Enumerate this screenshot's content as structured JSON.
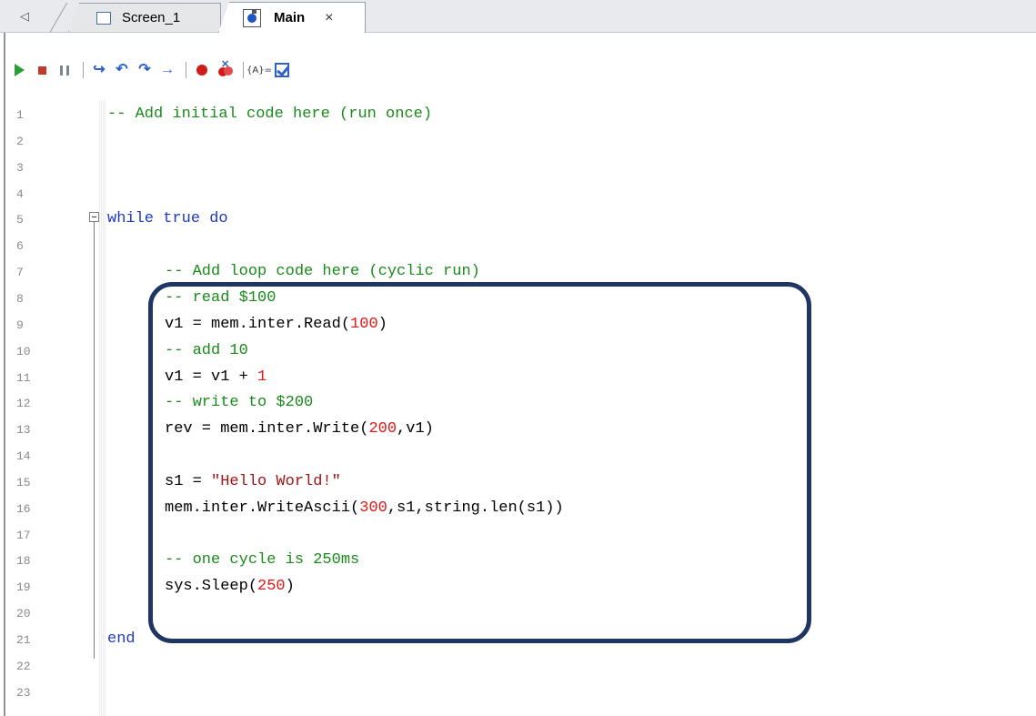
{
  "tabs": {
    "items": [
      {
        "label": "Screen_1",
        "icon": "screen-icon"
      },
      {
        "label": "Main",
        "icon": "script-icon",
        "close": "×"
      }
    ]
  },
  "toolbar": {
    "buttons": [
      "play-icon",
      "stop-icon",
      "pause-icon",
      "step-into-icon",
      "step-over-icon",
      "step-out-icon",
      "run-to-cursor-icon",
      "breakpoint-icon",
      "clear-breakpoints-icon",
      "watch-icon",
      "check-syntax-icon"
    ],
    "watch_label": "{A}="
  },
  "editor": {
    "line_numbers": [
      "1",
      "2",
      "3",
      "4",
      "5",
      "6",
      "7",
      "8",
      "9",
      "10",
      "11",
      "12",
      "13",
      "14",
      "15",
      "16",
      "17",
      "18",
      "19",
      "20",
      "21",
      "22",
      "23"
    ],
    "lines": [
      {
        "n": 1,
        "indent": 0,
        "parts": [
          {
            "t": "-- Add initial code here (run once)",
            "c": "cm"
          }
        ]
      },
      {
        "n": 5,
        "indent": 0,
        "parts": [
          {
            "t": "while",
            "c": "kw"
          },
          {
            "t": " "
          },
          {
            "t": "true",
            "c": "kw"
          },
          {
            "t": " "
          },
          {
            "t": "do",
            "c": "kw"
          }
        ]
      },
      {
        "n": 7,
        "indent": 1,
        "parts": [
          {
            "t": "-- Add loop code here (cyclic run)",
            "c": "cm"
          }
        ]
      },
      {
        "n": 8,
        "indent": 1,
        "parts": [
          {
            "t": "-- read $100",
            "c": "cm"
          }
        ]
      },
      {
        "n": 9,
        "indent": 1,
        "parts": [
          {
            "t": "v1 = mem.inter.Read("
          },
          {
            "t": "100",
            "c": "num"
          },
          {
            "t": ")"
          }
        ]
      },
      {
        "n": 10,
        "indent": 1,
        "parts": [
          {
            "t": "-- add 10",
            "c": "cm"
          }
        ]
      },
      {
        "n": 11,
        "indent": 1,
        "parts": [
          {
            "t": "v1 = v1 + "
          },
          {
            "t": "1",
            "c": "num"
          }
        ]
      },
      {
        "n": 12,
        "indent": 1,
        "parts": [
          {
            "t": "-- write to $200",
            "c": "cm"
          }
        ]
      },
      {
        "n": 13,
        "indent": 1,
        "parts": [
          {
            "t": "rev = mem.inter.Write("
          },
          {
            "t": "200",
            "c": "num"
          },
          {
            "t": ",v1)"
          }
        ]
      },
      {
        "n": 15,
        "indent": 1,
        "parts": [
          {
            "t": "s1 = "
          },
          {
            "t": "\"Hello World!\"",
            "c": "str"
          }
        ]
      },
      {
        "n": 16,
        "indent": 1,
        "parts": [
          {
            "t": "mem.inter.WriteAscii("
          },
          {
            "t": "300",
            "c": "num"
          },
          {
            "t": ",s1,string.len(s1))"
          }
        ]
      },
      {
        "n": 18,
        "indent": 1,
        "parts": [
          {
            "t": "-- one cycle is 250ms",
            "c": "cm"
          }
        ]
      },
      {
        "n": 19,
        "indent": 1,
        "parts": [
          {
            "t": "sys.Sleep("
          },
          {
            "t": "250",
            "c": "num"
          },
          {
            "t": ")"
          }
        ]
      },
      {
        "n": 21,
        "indent": 0,
        "parts": [
          {
            "t": "end",
            "c": "kw"
          }
        ]
      }
    ]
  },
  "colors": {
    "comment": "#1a8a1a",
    "keyword": "#1f39c9",
    "number": "#e01818",
    "string": "#a31515",
    "highlight_border": "#1f3563"
  }
}
